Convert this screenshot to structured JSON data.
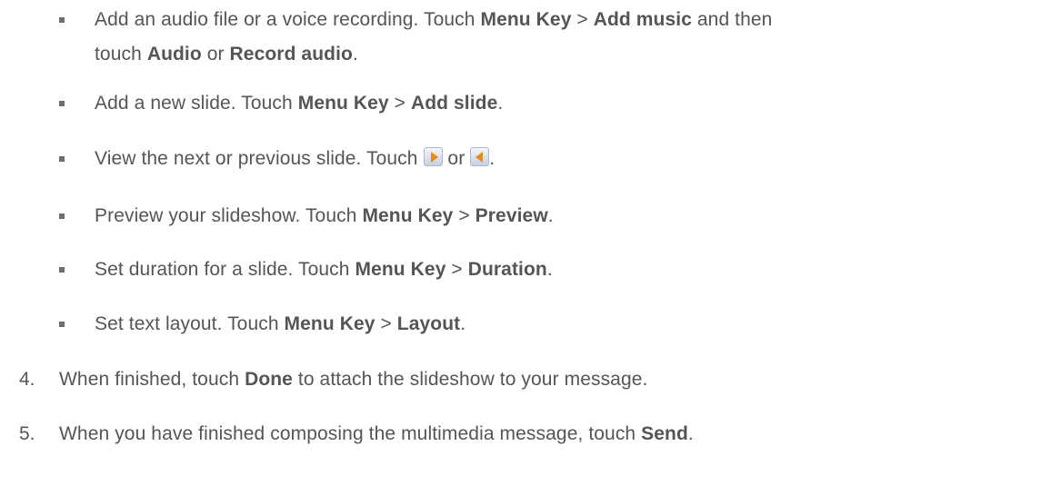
{
  "bullets": [
    {
      "text_a": "Add an audio file or a voice recording. Touch ",
      "b1": "Menu Key",
      "sep1": " > ",
      "b2": "Add music",
      "text_b": " and then",
      "line2_a": "touch ",
      "b3": "Audio",
      "or": " or ",
      "b4": "Record audio",
      "end": "."
    },
    {
      "text_a": "Add a new slide. Touch ",
      "b1": "Menu Key",
      "sep1": " > ",
      "b2": "Add slide",
      "end": "."
    },
    {
      "text_a": "View the next or previous slide. Touch ",
      "or": " or ",
      "end": ".",
      "icon_next": "next-slide-icon",
      "icon_prev": "previous-slide-icon"
    },
    {
      "text_a": "Preview your slideshow. Touch ",
      "b1": "Menu Key",
      "sep1": " > ",
      "b2": "Preview",
      "end": "."
    },
    {
      "text_a": "Set duration for a slide. Touch ",
      "b1": "Menu Key",
      "sep1": " > ",
      "b2": "Duration",
      "end": "."
    },
    {
      "text_a": "Set text layout. Touch ",
      "b1": "Menu Key",
      "sep1": " > ",
      "b2": "Layout",
      "end": "."
    }
  ],
  "steps": [
    {
      "num": "4.",
      "text_a": "When finished, touch ",
      "b1": "Done",
      "text_b": " to attach the slideshow to your message."
    },
    {
      "num": "5.",
      "text_a": "When you have finished composing the multimedia message, touch ",
      "b1": "Send",
      "end": "."
    }
  ]
}
